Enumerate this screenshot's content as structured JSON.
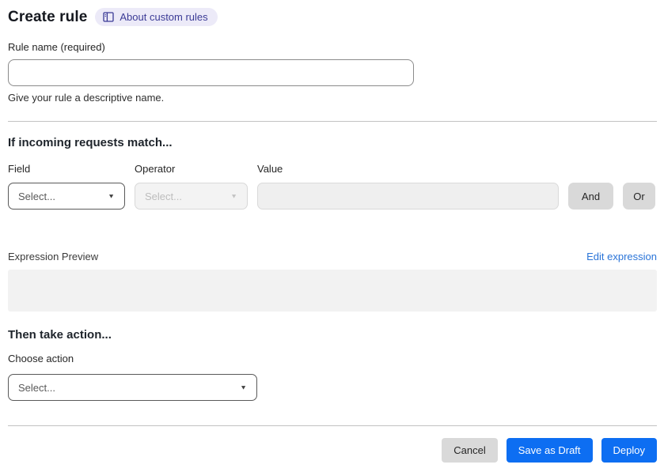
{
  "header": {
    "title": "Create rule",
    "badge": {
      "label": "About custom rules",
      "icon": "book-icon"
    }
  },
  "rule_name": {
    "label": "Rule name (required)",
    "value": "",
    "placeholder": "",
    "helper": "Give your rule a descriptive name."
  },
  "match_section": {
    "heading": "If incoming requests match...",
    "field": {
      "label": "Field",
      "value": "Select...",
      "enabled": true
    },
    "operator": {
      "label": "Operator",
      "value": "Select...",
      "enabled": false
    },
    "value_input": {
      "label": "Value",
      "value": "",
      "enabled": false
    },
    "and_button": "And",
    "or_button": "Or"
  },
  "expression": {
    "label": "Expression Preview",
    "edit_link": "Edit expression",
    "content": ""
  },
  "action_section": {
    "heading": "Then take action...",
    "choose_label": "Choose action",
    "value": "Select..."
  },
  "footer": {
    "cancel": "Cancel",
    "save_draft": "Save as Draft",
    "deploy": "Deploy"
  },
  "colors": {
    "primary_button": "#0d6ef2",
    "link_blue": "#2a74d8",
    "badge_bg": "#eceaf8",
    "badge_text": "#3b3b96",
    "gray_button": "#d9d9d9",
    "disabled_bg": "#f3f3f3",
    "preview_bg": "#f2f2f2"
  }
}
